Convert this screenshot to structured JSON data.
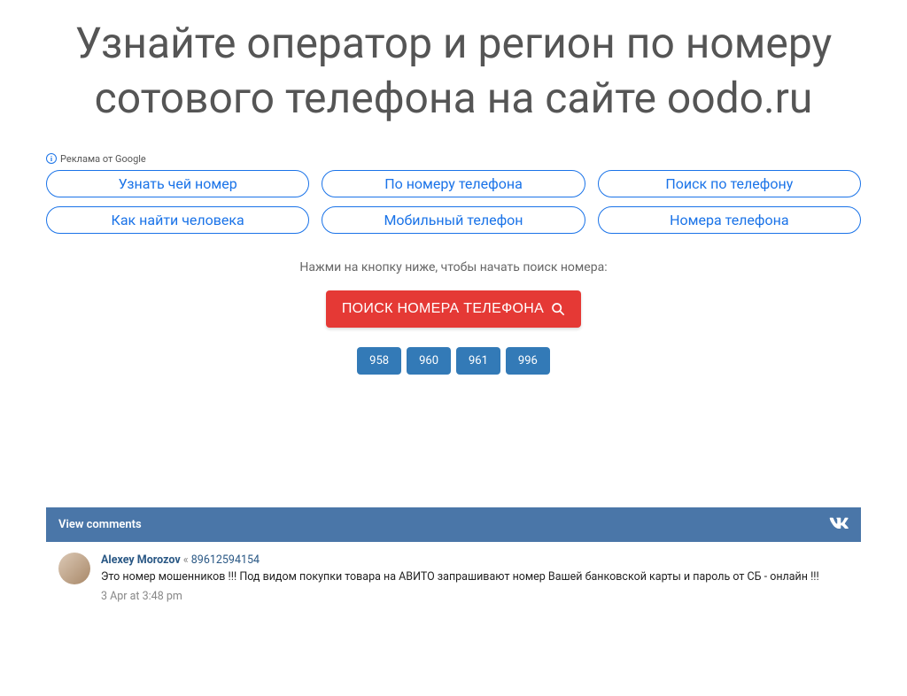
{
  "header": {
    "title": "Узнайте оператор и регион по номеру сотового телефона на сайте oodo.ru"
  },
  "ads": {
    "label": "Реклама от Google",
    "items": [
      "Узнать чей номер",
      "По номеру телефона",
      "Поиск по телефону",
      "Как найти человека",
      "Мобильный телефон",
      "Номера телефона"
    ]
  },
  "search": {
    "prompt": "Нажми на кнопку ниже, чтобы начать поиск номера:",
    "button_label": "ПОИСК НОМЕРА ТЕЛЕФОНА"
  },
  "codes": [
    "958",
    "960",
    "961",
    "996"
  ],
  "comments": {
    "header_label": "View comments",
    "items": [
      {
        "author": "Alexey Morozov",
        "separator": "«",
        "link": "89612594154",
        "text": "Это номер мошенников !!! Под видом покупки товара на АВИТО запрашивают номер Вашей банковской карты и пароль от СБ - онлайн !!!",
        "date": "3 Apr at 3:48 pm"
      }
    ]
  }
}
